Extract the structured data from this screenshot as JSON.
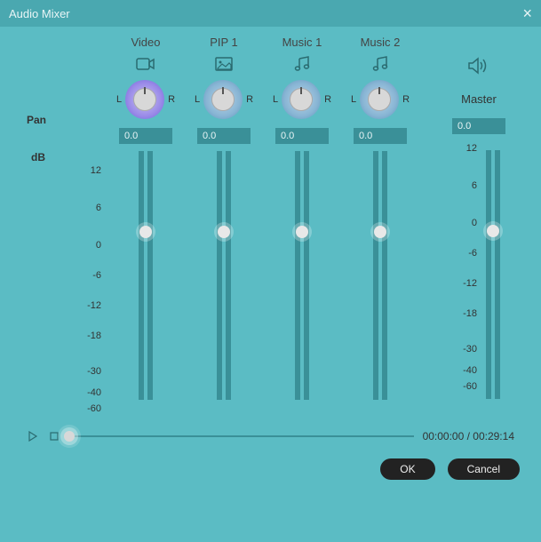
{
  "window": {
    "title": "Audio Mixer"
  },
  "labels": {
    "pan": "Pan",
    "db": "dB",
    "L": "L",
    "R": "R",
    "master": "Master"
  },
  "scale": [
    "12",
    "6",
    "0",
    "-6",
    "-12",
    "-18",
    "-30",
    "-40",
    "-60"
  ],
  "channels": [
    {
      "name": "Video",
      "icon": "camera",
      "db": "0.0"
    },
    {
      "name": "PIP 1",
      "icon": "image",
      "db": "0.0"
    },
    {
      "name": "Music 1",
      "icon": "music",
      "db": "0.0"
    },
    {
      "name": "Music 2",
      "icon": "music",
      "db": "0.0"
    }
  ],
  "master": {
    "icon": "speaker",
    "db": "0.0"
  },
  "playback": {
    "time": "00:00:00 / 00:29:14"
  },
  "buttons": {
    "ok": "OK",
    "cancel": "Cancel"
  }
}
